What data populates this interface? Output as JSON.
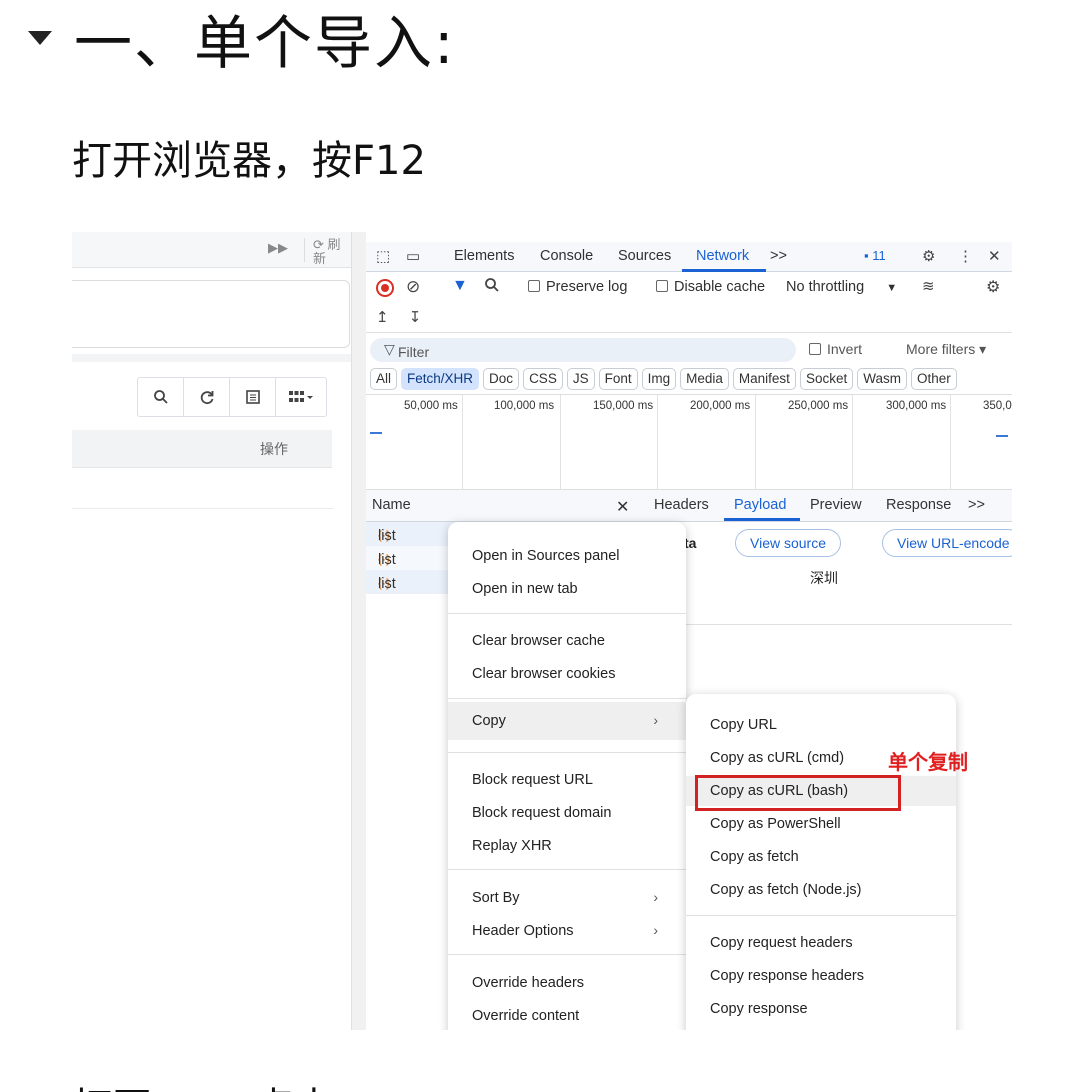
{
  "heading": "一、单个导入:",
  "paragraph": "打开浏览器，按F12",
  "bottom_text": "打开 ...... 点击",
  "left_page": {
    "refresh_label": "⟳ 刷新",
    "forward_icon": "▶▶",
    "toolbar_icons": [
      "search-icon",
      "refresh-icon",
      "list-icon",
      "grid-icon"
    ],
    "op_header": "操作"
  },
  "devtools": {
    "tabs": [
      "Elements",
      "Console",
      "Sources",
      "Network"
    ],
    "active_tab": "Network",
    "more_tabs": ">>",
    "issues_badge": "11",
    "toolbar": {
      "preserve_log": "Preserve log",
      "disable_cache": "Disable cache",
      "throttling": "No throttling"
    },
    "filter_placeholder": "Filter",
    "invert": "Invert",
    "more_filters": "More filters ▾",
    "type_filters": [
      "All",
      "Fetch/XHR",
      "Doc",
      "CSS",
      "JS",
      "Font",
      "Img",
      "Media",
      "Manifest",
      "Socket",
      "Wasm",
      "Other"
    ],
    "active_type": "Fetch/XHR",
    "timeline_labels": [
      "50,000 ms",
      "100,000 ms",
      "150,000 ms",
      "200,000 ms",
      "250,000 ms",
      "300,000 ms",
      "350,0"
    ],
    "name_header": "Name",
    "detail_tabs": [
      "Headers",
      "Payload",
      "Preview",
      "Response",
      ">>"
    ],
    "active_detail_tab": "Payload",
    "requests": [
      "list",
      "list",
      "list"
    ],
    "payload": {
      "ta": "ta",
      "view_source": "View source",
      "view_url_encoded": "View URL-encode",
      "city": "深圳"
    }
  },
  "context_menu": {
    "items": [
      {
        "label": "Open in Sources panel"
      },
      {
        "label": "Open in new tab"
      },
      {
        "label": "Clear browser cache"
      },
      {
        "label": "Clear browser cookies"
      },
      {
        "label": "Copy",
        "submenu": true
      },
      {
        "label": "Block request URL"
      },
      {
        "label": "Block request domain"
      },
      {
        "label": "Replay XHR"
      },
      {
        "label": "Sort By",
        "submenu": true
      },
      {
        "label": "Header Options",
        "submenu": true
      },
      {
        "label": "Override headers"
      },
      {
        "label": "Override content"
      }
    ]
  },
  "copy_submenu": {
    "items": [
      "Copy URL",
      "Copy as cURL (cmd)",
      "Copy as cURL (bash)",
      "Copy as PowerShell",
      "Copy as fetch",
      "Copy as fetch (Node.js)",
      "Copy request headers",
      "Copy response headers",
      "Copy response"
    ],
    "highlighted": "Copy as cURL (bash)"
  },
  "annotation": "单个复制",
  "colors": {
    "accent": "#1a62d3",
    "annotation_red": "#e02020",
    "record_red": "#d93025"
  }
}
